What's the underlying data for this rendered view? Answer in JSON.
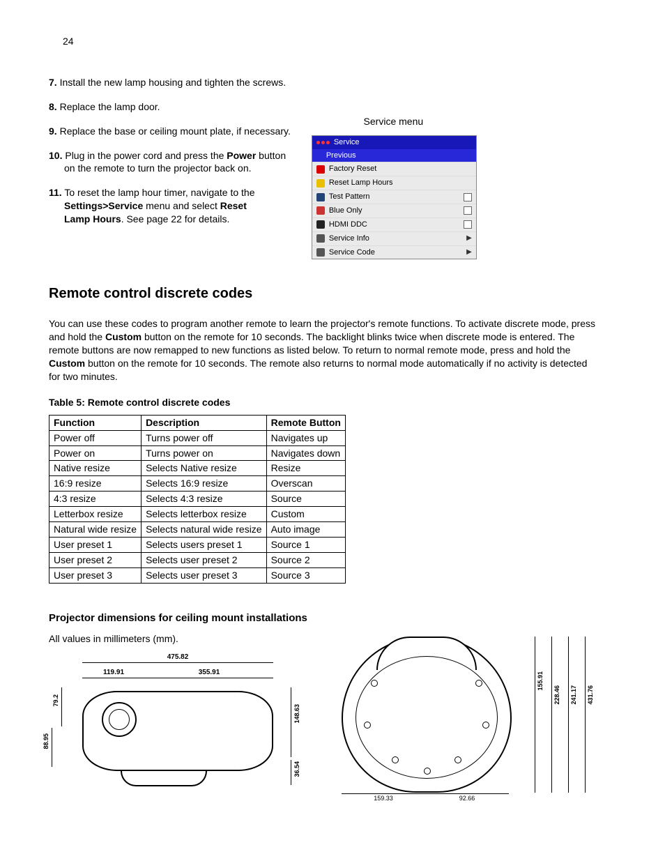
{
  "page_number": "24",
  "steps": [
    {
      "n": "7.",
      "text": "Install the new lamp housing and tighten the screws."
    },
    {
      "n": "8.",
      "text": "Replace the lamp door."
    },
    {
      "n": "9.",
      "text": "Replace the base or ceiling mount plate, if necessary."
    },
    {
      "n": "10.",
      "pre": "Plug in the power cord and press the ",
      "bold": "Power",
      "post": " button",
      "line2": "on the remote to turn the projector back on."
    },
    {
      "n": "11.",
      "pre": "To reset the lamp hour timer, navigate to the",
      "line2a": "Settings>Service",
      "line2b": " menu and select ",
      "line2c": "Reset",
      "line3a": "Lamp Hours",
      "line3b": ". See page 22 for details."
    }
  ],
  "service_label": "Service menu",
  "service_menu": {
    "title": "Service",
    "previous": "Previous",
    "items": [
      {
        "label": "Factory Reset",
        "icon": "#d00",
        "right": ""
      },
      {
        "label": "Reset Lamp Hours",
        "icon": "#e8c000",
        "right": ""
      },
      {
        "label": "Test Pattern",
        "icon": "#247",
        "right": "check"
      },
      {
        "label": "Blue Only",
        "icon": "#c33",
        "right": "check"
      },
      {
        "label": "HDMI DDC",
        "icon": "#222",
        "right": "check"
      },
      {
        "label": "Service Info",
        "icon": "#555",
        "right": "arrow"
      },
      {
        "label": "Service Code",
        "icon": "#555",
        "right": "arrow"
      }
    ]
  },
  "section_heading": "Remote control discrete codes",
  "para_parts": {
    "p1": "You can use these codes to program another remote to learn the projector's remote functions. To activate discrete mode, press and hold the ",
    "b1": "Custom",
    "p2": " button on the remote for 10 seconds. The backlight blinks twice when discrete mode is entered. The remote buttons are now remapped to new functions as listed below. To return to normal remote mode, press and hold the ",
    "b2": "Custom",
    "p3": " button on the remote for 10 seconds. The remote also returns to normal mode automatically if no activity is detected for two minutes."
  },
  "table_caption": "Table 5: Remote control discrete codes",
  "table_headers": [
    "Function",
    "Description",
    "Remote Button"
  ],
  "table_rows": [
    [
      "Power off",
      "Turns power off",
      "Navigates up"
    ],
    [
      "Power on",
      "Turns power on",
      "Navigates down"
    ],
    [
      "Native resize",
      "Selects Native resize",
      "Resize"
    ],
    [
      "16:9 resize",
      "Selects 16:9 resize",
      "Overscan"
    ],
    [
      "4:3 resize",
      "Selects 4:3 resize",
      "Source"
    ],
    [
      "Letterbox resize",
      "Selects letterbox resize",
      "Custom"
    ],
    [
      "Natural wide resize",
      "Selects natural wide resize",
      "Auto image"
    ],
    [
      "User preset 1",
      "Selects users preset 1",
      "Source 1"
    ],
    [
      "User preset 2",
      "Selects user preset 2",
      "Source 2"
    ],
    [
      "User preset 3",
      "Selects user preset 3",
      "Source 3"
    ]
  ],
  "dim_heading": "Projector dimensions for ceiling mount installations",
  "dim_note": "All values in millimeters (mm).",
  "front_dims": {
    "total_w": "475.82",
    "left_w": "119.91",
    "right_w": "355.91",
    "left_h_top": "79.2",
    "left_h_bot": "88.95",
    "right_h_top": "148.63",
    "right_h_bot": "36.54"
  },
  "top_dims": {
    "r1": "155.91",
    "r2": "228.46",
    "r3": "241.17",
    "r4": "431.76",
    "b1": "159.33",
    "b2": "92.66"
  }
}
